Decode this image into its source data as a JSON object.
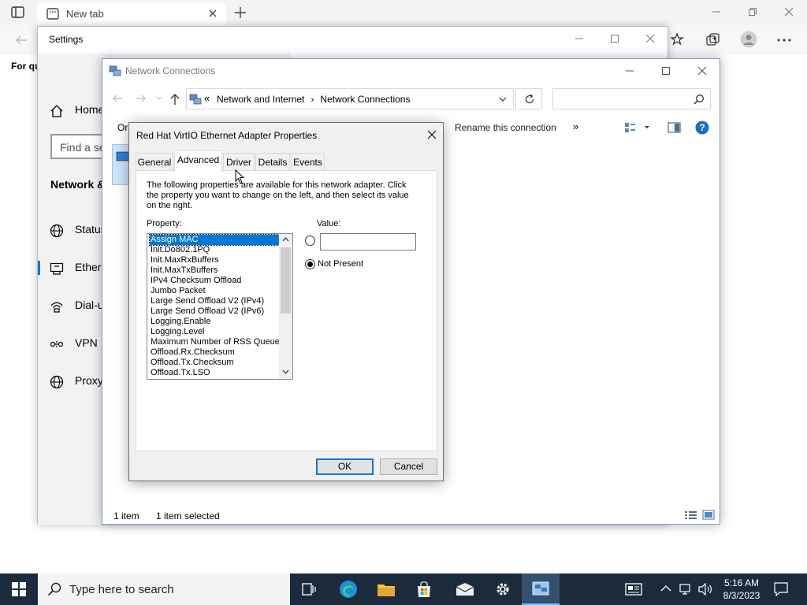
{
  "browser": {
    "tab_title": "New tab",
    "favbar_text": "For qu"
  },
  "settings": {
    "title": "Settings",
    "home": "Home",
    "search_placeholder": "Find a se",
    "section": "Network &",
    "nav": [
      {
        "label": "Status",
        "icon": "globe-icon"
      },
      {
        "label": "Ethern",
        "icon": "ethernet-icon"
      },
      {
        "label": "Dial-u",
        "icon": "dialup-icon"
      },
      {
        "label": "VPN",
        "icon": "vpn-icon"
      },
      {
        "label": "Proxy",
        "icon": "globe-icon"
      }
    ]
  },
  "netconn": {
    "title": "Network Connections",
    "breadcrumb": [
      "Network and Internet",
      "Network Connections"
    ],
    "cmd_org": "Or",
    "rename": "Rename this connection",
    "more": "»",
    "status_count": "1 item",
    "status_selected": "1 item selected"
  },
  "dialog": {
    "title": "Red Hat VirtIO Ethernet Adapter Properties",
    "tabs": [
      "General",
      "Advanced",
      "Driver",
      "Details",
      "Events"
    ],
    "description": "The following properties are available for this network adapter. Click the property you want to change on the left, and then select its value on the right.",
    "property_label": "Property:",
    "value_label": "Value:",
    "properties": [
      "Assign MAC",
      "Init.Do802.1PQ",
      "Init.MaxRxBuffers",
      "Init.MaxTxBuffers",
      "IPv4 Checksum Offload",
      "Jumbo Packet",
      "Large Send Offload V2 (IPv4)",
      "Large Send Offload V2 (IPv6)",
      "Logging.Enable",
      "Logging.Level",
      "Maximum Number of RSS Queues",
      "Offload.Rx.Checksum",
      "Offload.Tx.Checksum",
      "Offload.Tx.LSO"
    ],
    "selected_property": "Assign MAC",
    "value_text": "",
    "not_present": "Not Present",
    "ok": "OK",
    "cancel": "Cancel"
  },
  "taskbar": {
    "search_placeholder": "Type here to search",
    "time": "5:16 AM",
    "date": "8/3/2023"
  }
}
